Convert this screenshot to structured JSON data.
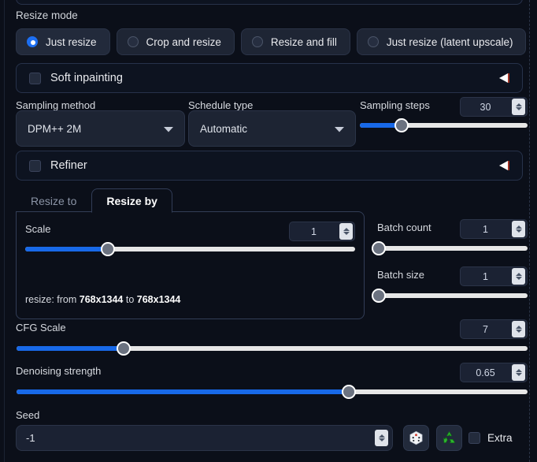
{
  "resize_mode": {
    "label": "Resize mode",
    "options": [
      {
        "label": "Just resize",
        "selected": true
      },
      {
        "label": "Crop and resize",
        "selected": false
      },
      {
        "label": "Resize and fill",
        "selected": false
      },
      {
        "label": "Just resize (latent upscale)",
        "selected": false
      }
    ]
  },
  "soft_inpainting": {
    "label": "Soft inpainting",
    "checked": false,
    "expanded": false
  },
  "sampling": {
    "method_label": "Sampling method",
    "method_value": "DPM++ 2M",
    "schedule_label": "Schedule type",
    "schedule_value": "Automatic",
    "steps_label": "Sampling steps",
    "steps_value": "30",
    "steps_percent": 25
  },
  "refiner": {
    "label": "Refiner",
    "checked": false,
    "expanded": false
  },
  "resize_tabs": {
    "tabs": [
      {
        "label": "Resize to",
        "active": false
      },
      {
        "label": "Resize by",
        "active": true
      }
    ],
    "scale_label": "Scale",
    "scale_value": "1",
    "scale_percent": 25,
    "resize_note_prefix": "resize: from ",
    "resize_note_from": "768x1344",
    "resize_note_mid": " to ",
    "resize_note_to": "768x1344"
  },
  "batch": {
    "count_label": "Batch count",
    "count_value": "1",
    "count_percent": 0,
    "size_label": "Batch size",
    "size_value": "1",
    "size_percent": 0
  },
  "cfg": {
    "label": "CFG Scale",
    "value": "7",
    "percent": 21
  },
  "denoise": {
    "label": "Denoising strength",
    "value": "0.65",
    "percent": 65
  },
  "seed": {
    "label": "Seed",
    "value": "-1",
    "random_icon": "dice-icon",
    "recycle_icon": "recycle-icon",
    "extra_label": "Extra",
    "extra_checked": false
  },
  "colors": {
    "accent_blue": "#1869e8",
    "radio_blue": "#1d6ff2",
    "track_gray": "#e6e6e6",
    "knob_gray": "#6b7280",
    "panel_bg": "#0b0f19",
    "recycle_green": "#2fa82f"
  }
}
